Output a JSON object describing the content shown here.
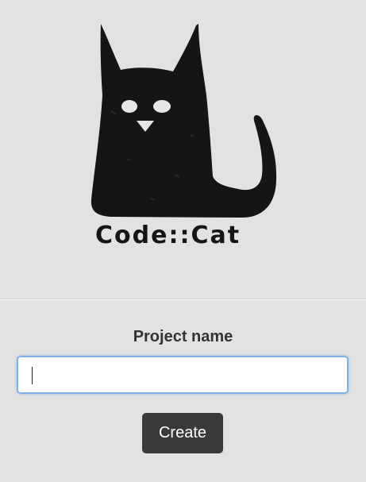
{
  "logo": {
    "text": "Code::Cat",
    "icon": "cat-logo-icon"
  },
  "form": {
    "label": "Project name",
    "input_value": "",
    "input_placeholder": "",
    "create_label": "Create"
  },
  "colors": {
    "background": "#e2e2e2",
    "button_bg": "#3a3a3a",
    "button_text": "#ffffff",
    "input_focus_border": "#7fb1e6",
    "label_text": "#333333"
  }
}
